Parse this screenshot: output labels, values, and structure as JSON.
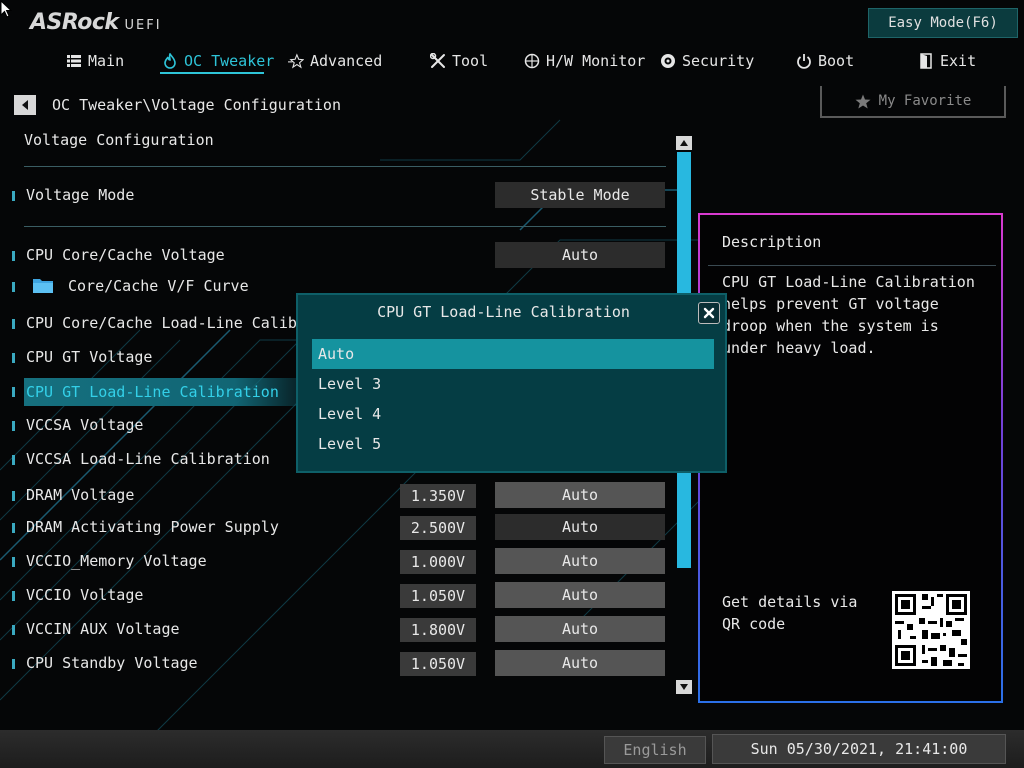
{
  "brand": {
    "name": "ASRock",
    "sub": "UEFI"
  },
  "easy_mode_label": "Easy Mode(F6)",
  "nav": {
    "main": "Main",
    "oc_tweaker": "OC Tweaker",
    "advanced": "Advanced",
    "tool": "Tool",
    "hw_monitor": "H/W Monitor",
    "security": "Security",
    "boot": "Boot",
    "exit": "Exit"
  },
  "breadcrumb": "OC Tweaker\\Voltage Configuration",
  "favorite_label": "My Favorite",
  "section_title": "Voltage Configuration",
  "rows": {
    "voltage_mode": {
      "label": "Voltage Mode",
      "option": "Stable Mode"
    },
    "cpu_core_cache_voltage": {
      "label": "CPU Core/Cache Voltage",
      "option": "Auto"
    },
    "vf_curve": {
      "label": "Core/Cache V/F Curve"
    },
    "cpu_core_llc": {
      "label": "CPU Core/Cache Load-Line Calibrat"
    },
    "cpu_gt_voltage": {
      "label": "CPU GT Voltage"
    },
    "cpu_gt_llc": {
      "label": "CPU GT Load-Line Calibration"
    },
    "vccsa_voltage": {
      "label": "VCCSA Voltage"
    },
    "vccsa_llc": {
      "label": "VCCSA Load-Line Calibration"
    },
    "dram_voltage": {
      "label": "DRAM Voltage",
      "value": "1.350V",
      "option": "Auto"
    },
    "dram_activating": {
      "label": "DRAM Activating Power Supply",
      "value": "2.500V",
      "option": "Auto"
    },
    "vccio_memory": {
      "label": "VCCIO_Memory Voltage",
      "value": "1.000V",
      "option": "Auto"
    },
    "vccio": {
      "label": "VCCIO Voltage",
      "value": "1.050V",
      "option": "Auto"
    },
    "vccin_aux": {
      "label": "VCCIN AUX Voltage",
      "value": "1.800V",
      "option": "Auto"
    },
    "cpu_standby": {
      "label": "CPU Standby Voltage",
      "value": "1.050V",
      "option": "Auto"
    }
  },
  "description": {
    "title": "Description",
    "text": "CPU GT Load-Line Calibration helps prevent GT voltage droop when the system is under heavy load.",
    "qr_label": "Get details via QR code"
  },
  "dialog": {
    "title": "CPU GT Load-Line Calibration",
    "options": [
      "Auto",
      "Level 3",
      "Level 4",
      "Level 5"
    ],
    "selected": "Auto"
  },
  "footer": {
    "language": "English",
    "datetime": "Sun 05/30/2021, 21:41:00"
  },
  "colors": {
    "accent": "#2ec4d8",
    "selected_bg": "#15939f",
    "dialog_bg": "#053d44",
    "scroll_thumb": "#28b8e0"
  }
}
